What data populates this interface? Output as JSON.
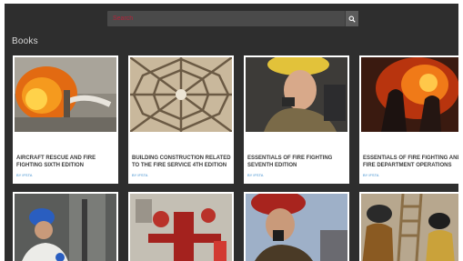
{
  "search": {
    "placeholder": "Search"
  },
  "section": {
    "title": "Books"
  },
  "books": [
    {
      "title": "Aircraft Rescue and Fire Fighting Sixth Edition",
      "author": "by IFSTA"
    },
    {
      "title": "Building Construction Related to the Fire Service 4th Edition",
      "author": "by IFSTA"
    },
    {
      "title": "Essentials of Fire Fighting Seventh Edition",
      "author": "by IFSTA"
    },
    {
      "title": "Essentials of Fire Fighting and Fire Department Operations",
      "author": "by IFSTA"
    },
    {
      "title": "",
      "author": ""
    },
    {
      "title": "",
      "author": ""
    },
    {
      "title": "",
      "author": ""
    },
    {
      "title": "",
      "author": ""
    }
  ],
  "colors": {
    "background": "#2e2e2e",
    "search_bar": "#4a4a4a",
    "author": "#3f8fcf",
    "placeholder": "#b4233a"
  }
}
